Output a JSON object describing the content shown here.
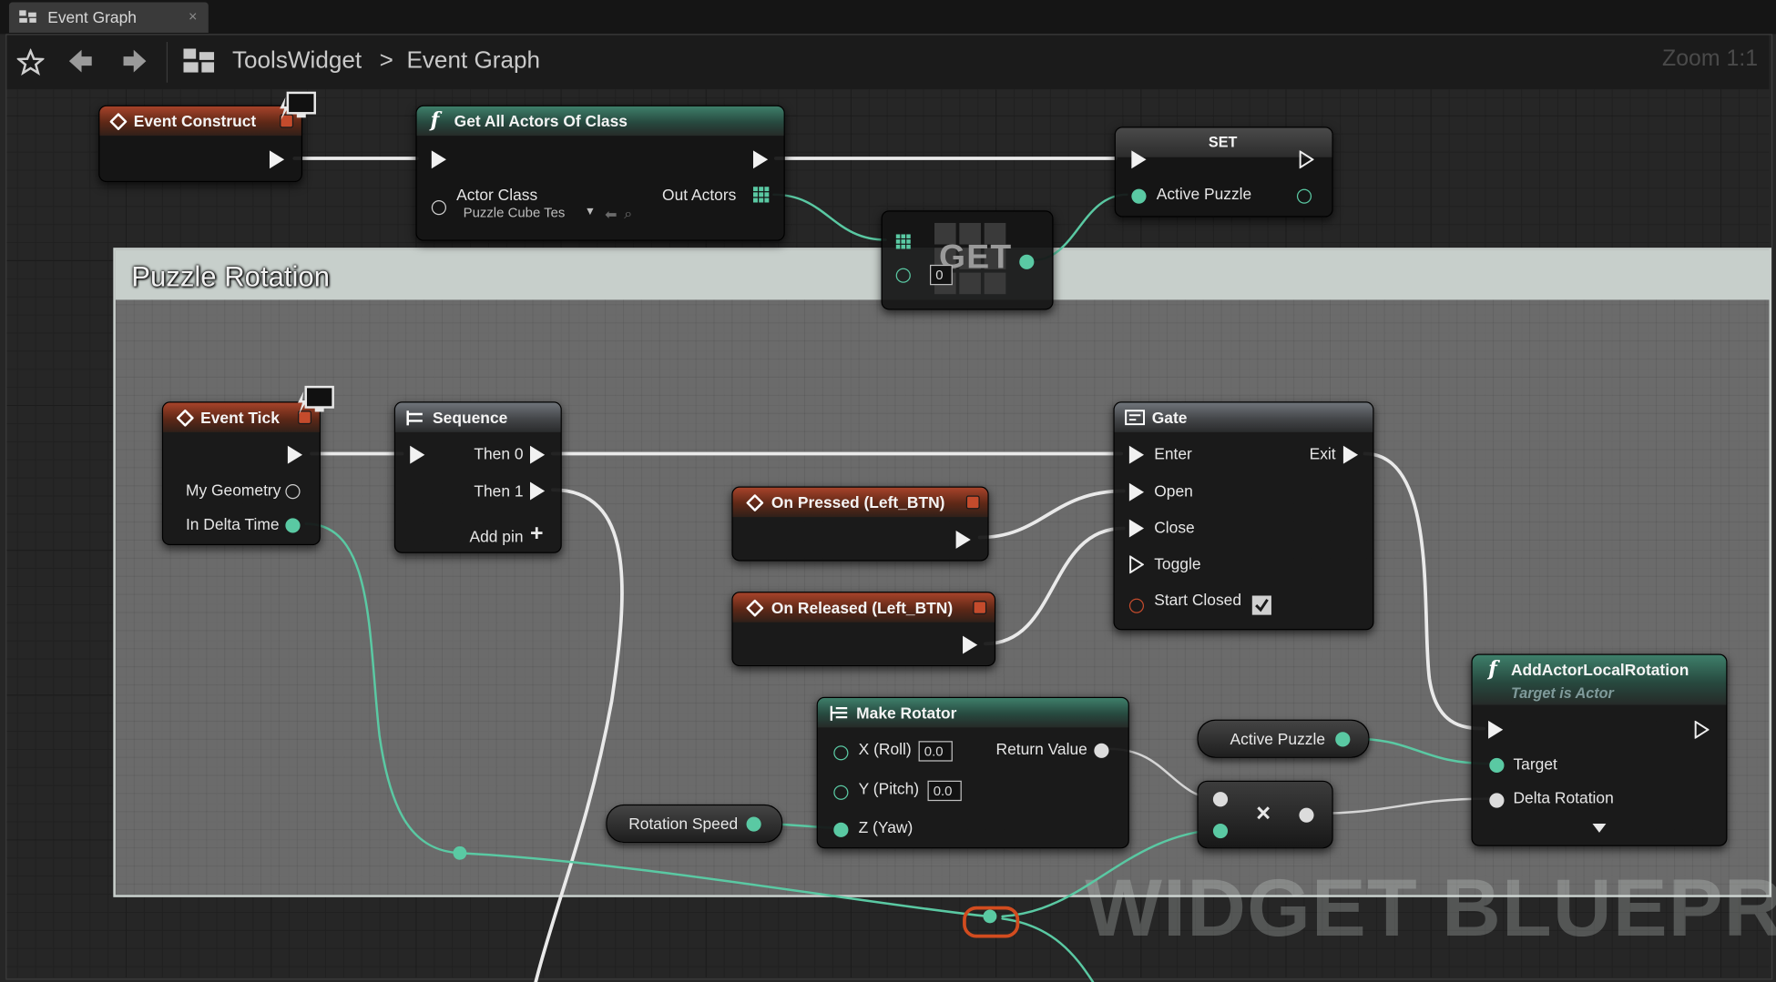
{
  "tab": {
    "title": "Event Graph",
    "close": "×"
  },
  "toolbar": {
    "breadcrumb_root": "ToolsWidget",
    "separator": ">",
    "breadcrumb_current": "Event Graph",
    "zoom": "Zoom 1:1"
  },
  "comment": {
    "title": "Puzzle Rotation"
  },
  "watermark": "WIDGET BLUEPRINT",
  "nodes": {
    "event_construct": {
      "title": "Event Construct"
    },
    "get_all_actors": {
      "title": "Get All Actors Of Class",
      "actor_class_label": "Actor Class",
      "actor_class_value": "Puzzle Cube Tes",
      "out_actors": "Out Actors"
    },
    "set": {
      "title": "SET",
      "pin": "Active Puzzle"
    },
    "get": {
      "title": "GET",
      "index": "0"
    },
    "event_tick": {
      "title": "Event Tick",
      "my_geometry": "My Geometry",
      "in_delta_time": "In Delta Time"
    },
    "sequence": {
      "title": "Sequence",
      "then0": "Then 0",
      "then1": "Then 1",
      "add_pin": "Add pin"
    },
    "gate": {
      "title": "Gate",
      "enter": "Enter",
      "open": "Open",
      "close": "Close",
      "toggle": "Toggle",
      "start_closed": "Start Closed",
      "exit": "Exit"
    },
    "on_pressed": {
      "title": "On Pressed (Left_BTN)"
    },
    "on_released": {
      "title": "On Released (Left_BTN)"
    },
    "make_rotator": {
      "title": "Make Rotator",
      "x": "X (Roll)",
      "x_value": "0.0",
      "y": "Y (Pitch)",
      "y_value": "0.0",
      "z": "Z (Yaw)",
      "return_value": "Return Value"
    },
    "add_rotation": {
      "title": "AddActorLocalRotation",
      "subtitle": "Target is Actor",
      "target": "Target",
      "delta_rotation": "Delta Rotation"
    },
    "active_puzzle_var": {
      "label": "Active Puzzle"
    },
    "rotation_speed_var": {
      "label": "Rotation Speed"
    },
    "multiply": {
      "symbol": "×"
    }
  },
  "colors": {
    "exec": "#f1f1f1",
    "float_wire": "#5ac9a3",
    "rotator_wire": "#dcdcdc",
    "event_header": "#a7432a",
    "function_header": "#3e7f6a",
    "highlight": "#d24c1f"
  }
}
